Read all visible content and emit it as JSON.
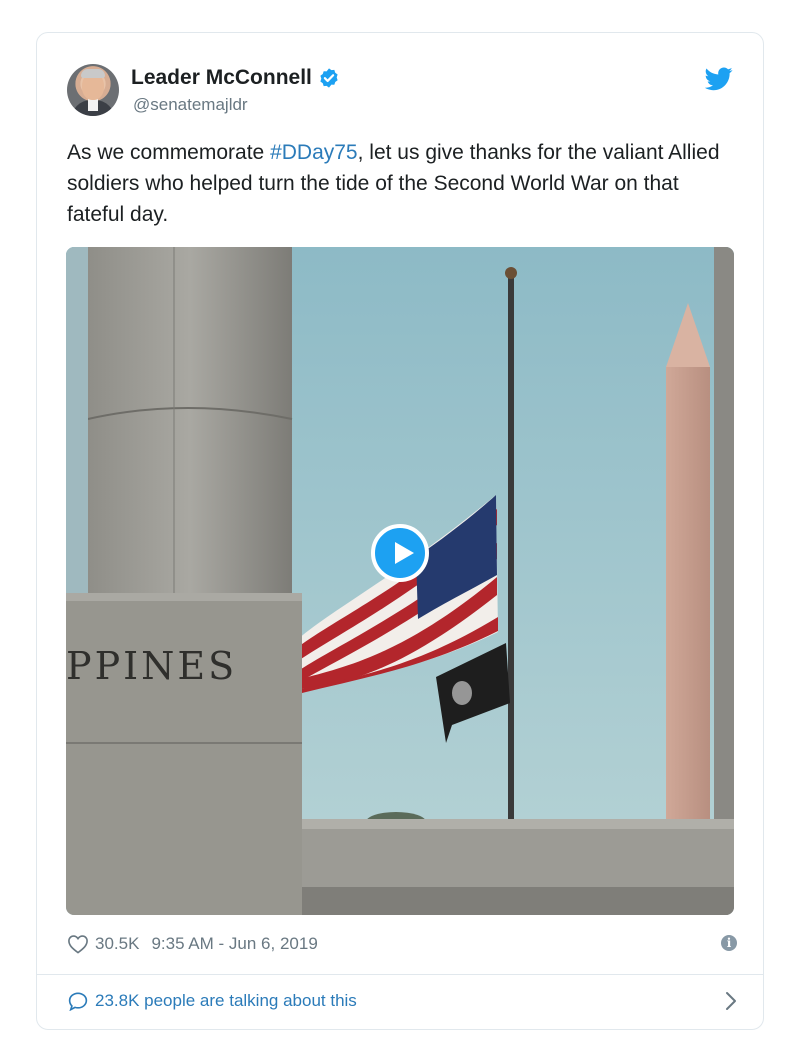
{
  "tweet": {
    "author": {
      "name": "Leader McConnell",
      "handle": "@senatemajldr",
      "verified": true
    },
    "text_before": "As we commemorate ",
    "hashtag": "#DDay75",
    "text_after": ", let us give thanks for the valiant Allied soldiers who helped turn the tide of the Second World War on that fateful day.",
    "media": {
      "type": "video",
      "engraving": "PPINES"
    },
    "likes": "30.5K",
    "timestamp": "9:35 AM - Jun 6, 2019",
    "talking": "23.8K people are talking about this"
  },
  "colors": {
    "link": "#2b7bb9",
    "twitter_blue": "#1da1f2",
    "muted": "#697882",
    "border": "#e1e8ed"
  },
  "icons": {
    "verified": "verified-badge-icon",
    "brand": "twitter-bird-icon",
    "like": "heart-icon",
    "info": "info-icon",
    "comment": "comment-icon",
    "chevron": "chevron-right-icon",
    "play": "play-icon"
  }
}
